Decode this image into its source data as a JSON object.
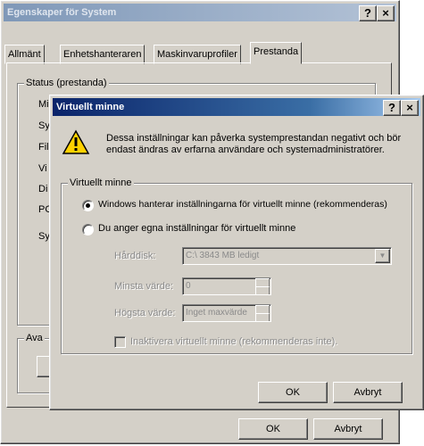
{
  "back": {
    "title": "Egenskaper för System",
    "help_btn": "?",
    "close_btn": "×",
    "tabs": [
      "Allmänt",
      "Enhetshanteraren",
      "Maskinvaruprofiler",
      "Prestanda"
    ],
    "status_legend": "Status (prestanda)",
    "side_letters": [
      "Mi",
      "Sy",
      "Fil",
      "Vi",
      "Di",
      "PC",
      "Sy"
    ],
    "ava_legend": "Ava",
    "ok_label": "OK",
    "cancel_label": "Avbryt"
  },
  "dialog": {
    "title": "Virtuellt minne",
    "help_btn": "?",
    "close_btn": "×",
    "warning_text": "Dessa inställningar kan påverka systemprestandan negativt och bör endast ändras av erfarna användare och systemadministratörer.",
    "group_legend": "Virtuellt minne",
    "option_windows": "Windows hanterar inställningarna för virtuellt minne (rekommenderas)",
    "option_custom": "Du anger egna inställningar för virtuellt minne",
    "selected_option": "windows",
    "disk_label": "Hårddisk:",
    "disk_value": "C:\\ 3843 MB ledigt",
    "min_label": "Minsta värde:",
    "min_value": "0",
    "max_label": "Högsta värde:",
    "max_value": "Inget maxvärde",
    "disable_label": "Inaktivera virtuellt minne (rekommenderas inte).",
    "ok_label": "OK",
    "cancel_label": "Avbryt"
  }
}
